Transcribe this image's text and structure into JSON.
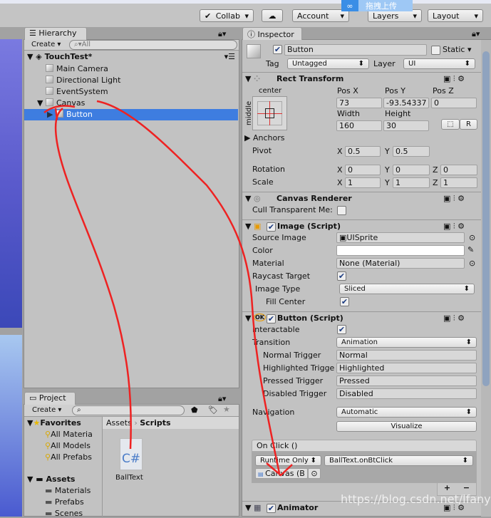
{
  "toolbar": {
    "collab": "Collab",
    "account": "Account",
    "layers": "Layers",
    "layout": "Layout",
    "upload_overlay": "拖拽上传"
  },
  "hierarchy": {
    "tab": "Hierarchy",
    "create": "Create",
    "search_placeholder": "All",
    "scene": "TouchTest*",
    "items": [
      "Main Camera",
      "Directional Light",
      "EventSystem",
      "Canvas",
      "Button"
    ],
    "selected": "Button"
  },
  "project": {
    "tab": "Project",
    "create": "Create",
    "favorites": {
      "label": "Favorites",
      "items": [
        "All Materia",
        "All Models",
        "All Prefabs"
      ]
    },
    "assets": {
      "label": "Assets",
      "items": [
        "Materials",
        "Prefabs",
        "Scenes"
      ]
    },
    "breadcrumb": [
      "Assets",
      "Scripts"
    ],
    "files": [
      {
        "name": "BallText",
        "icon": "C#"
      }
    ]
  },
  "inspector": {
    "tab": "Inspector",
    "name": "Button",
    "static": "Static",
    "tag_label": "Tag",
    "tag": "Untagged",
    "layer_label": "Layer",
    "layer": "UI",
    "rect": {
      "title": "Rect Transform",
      "anchor_h": "center",
      "anchor_v": "middle",
      "posx_l": "Pos X",
      "posy_l": "Pos Y",
      "posz_l": "Pos Z",
      "posx": "73",
      "posy": "-93.54337",
      "posz": "0",
      "w_l": "Width",
      "h_l": "Height",
      "w": "160",
      "h": "30",
      "r": "R",
      "anchors": "Anchors",
      "pivot": "Pivot",
      "pivot_x": "0.5",
      "pivot_y": "0.5",
      "rotation": "Rotation",
      "rot": [
        "0",
        "0",
        "0"
      ],
      "scale": "Scale",
      "scl": [
        "1",
        "1",
        "1"
      ],
      "x": "X",
      "y": "Y",
      "z": "Z"
    },
    "canvas_renderer": {
      "title": "Canvas Renderer",
      "cull": "Cull Transparent Me:"
    },
    "image": {
      "title": "Image (Script)",
      "source_l": "Source Image",
      "source": "UISprite",
      "color_l": "Color",
      "color": "#ffffff",
      "material_l": "Material",
      "material": "None (Material)",
      "raycast_l": "Raycast Target",
      "type_l": "Image Type",
      "type": "Sliced",
      "fill_l": "Fill Center"
    },
    "button": {
      "title": "Button (Script)",
      "interactable": "Interactable",
      "transition_l": "Transition",
      "transition": "Animation",
      "normal_l": "Normal Trigger",
      "normal": "Normal",
      "high_l": "Highlighted Trigge",
      "high": "Highlighted",
      "pressed_l": "Pressed Trigger",
      "pressed": "Pressed",
      "disabled_l": "Disabled Trigger",
      "disabled": "Disabled",
      "nav_l": "Navigation",
      "nav": "Automatic",
      "visualize": "Visualize",
      "onclick": "On Click ()",
      "runtime": "Runtime Only",
      "func": "BallText.onBtClick",
      "target": "Canvas (B",
      "plus": "+",
      "minus": "−"
    },
    "animator": {
      "title": "Animator"
    }
  },
  "watermark": "https://blog.csdn.net/lfanyize",
  "colors": {
    "selection": "#3e7de0",
    "annotation": "#ee2222"
  }
}
